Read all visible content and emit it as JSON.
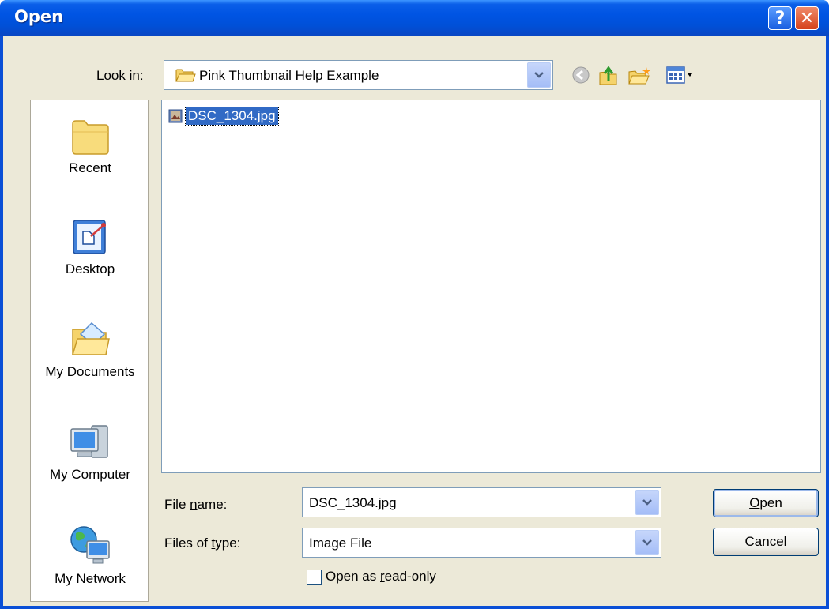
{
  "window": {
    "title": "Open",
    "help_glyph": "?",
    "close_glyph": "✕",
    "title_color": "#0054e3"
  },
  "look_in": {
    "label_pre": "Look ",
    "label_accel": "i",
    "label_post": "n:",
    "value": "Pink Thumbnail Help Example"
  },
  "toolbar": {
    "icons": [
      "back-icon",
      "up-folder-icon",
      "new-folder-icon",
      "views-menu-icon"
    ]
  },
  "places": [
    {
      "label": "Recent",
      "icon": "recent-icon"
    },
    {
      "label": "Desktop",
      "icon": "desktop-icon"
    },
    {
      "label": "My Documents",
      "icon": "my-documents-icon"
    },
    {
      "label": "My Computer",
      "icon": "my-computer-icon"
    },
    {
      "label": "My Network",
      "icon": "my-network-icon"
    }
  ],
  "files": [
    {
      "name": "DSC_1304.jpg",
      "selected": true,
      "icon": "image-file-icon"
    }
  ],
  "file_name": {
    "label_pre": "File ",
    "label_accel": "n",
    "label_post": "ame:",
    "value": "DSC_1304.jpg"
  },
  "file_type": {
    "label_pre": "Files of ",
    "label_accel": "t",
    "label_post": "ype:",
    "value": "Image File"
  },
  "buttons": {
    "open_accel": "O",
    "open_rest": "pen",
    "cancel": "Cancel"
  },
  "read_only": {
    "label_pre": "Open as ",
    "label_accel": "r",
    "label_post": "ead-only",
    "checked": false
  }
}
